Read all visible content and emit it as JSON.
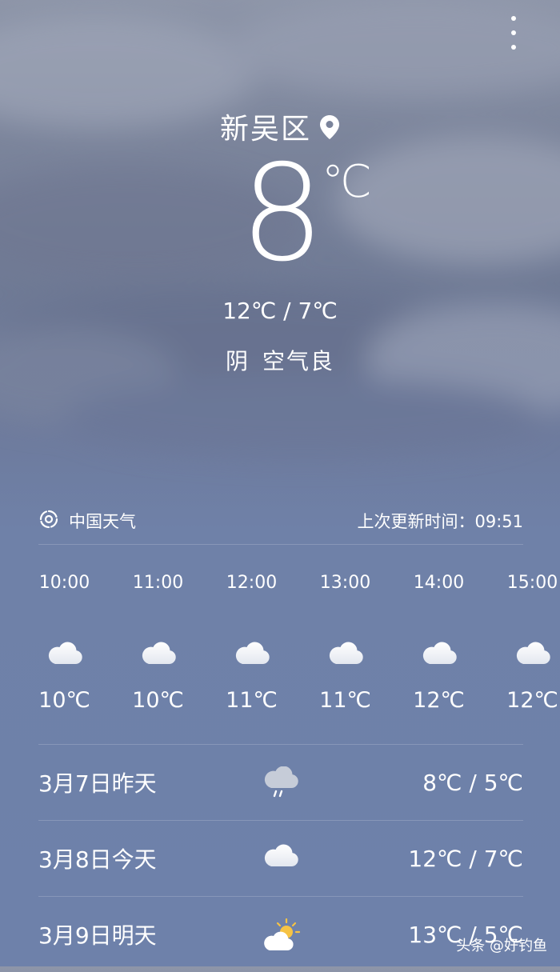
{
  "menu": {
    "icon": "more-vertical-icon"
  },
  "location": {
    "name": "新吴区",
    "icon": "location-pin-icon"
  },
  "current": {
    "temp": "8",
    "unit": "℃",
    "range": "12℃ / 7℃",
    "condition": "阴",
    "air_quality": "空气良"
  },
  "source": {
    "name": "中国天气",
    "icon": "china-weather-logo-icon",
    "updated": "上次更新时间：09:51"
  },
  "hourly": [
    {
      "time": "10:00",
      "temp": "10℃",
      "icon": "cloud-icon"
    },
    {
      "time": "11:00",
      "temp": "10℃",
      "icon": "cloud-icon"
    },
    {
      "time": "12:00",
      "temp": "11℃",
      "icon": "cloud-icon"
    },
    {
      "time": "13:00",
      "temp": "11℃",
      "icon": "cloud-icon"
    },
    {
      "time": "14:00",
      "temp": "12℃",
      "icon": "cloud-icon"
    },
    {
      "time": "15:00",
      "temp": "12℃",
      "icon": "cloud-icon"
    }
  ],
  "daily": [
    {
      "label": "3月7日昨天",
      "temp": "8℃ / 5℃",
      "icon": "rain-cloud-icon"
    },
    {
      "label": "3月8日今天",
      "temp": "12℃ / 7℃",
      "icon": "cloud-icon"
    },
    {
      "label": "3月9日明天",
      "temp": "13℃ / 5℃",
      "icon": "partly-sunny-icon"
    }
  ],
  "watermark": "头条 @好钓鱼",
  "colors": {
    "background_top": "#8d95a8",
    "background_bottom": "#6e81aa",
    "text": "#ffffff"
  }
}
